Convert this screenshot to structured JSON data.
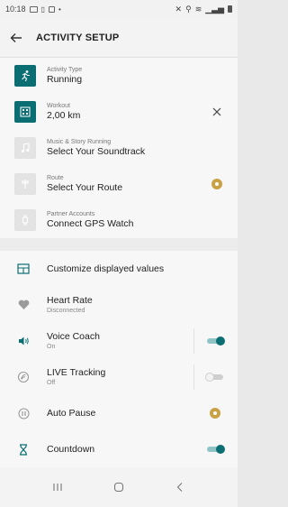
{
  "status_bar": {
    "time": "10:18",
    "icons": [
      "image-icon",
      "screen-icon",
      "notification-dot-icon"
    ],
    "right_icons": [
      "mute-icon",
      "location-icon",
      "wifi-icon",
      "signal-icon",
      "battery-icon"
    ]
  },
  "header": {
    "back_icon": "arrow-left-icon",
    "title": "ACTIVITY SETUP"
  },
  "setup": {
    "items": [
      {
        "label": "Activity Type",
        "value": "Running",
        "icon": "runner-icon",
        "tile": "teal",
        "action": ""
      },
      {
        "label": "Workout",
        "value": "2,00 km",
        "icon": "workout-grid-icon",
        "tile": "teal",
        "action": "close-icon"
      },
      {
        "label": "Music & Story Running",
        "value": "Select Your Soundtrack",
        "icon": "music-note-icon",
        "tile": "grey",
        "action": ""
      },
      {
        "label": "Route",
        "value": "Select Your Route",
        "icon": "route-sign-icon",
        "tile": "grey",
        "action": "premium-badge-icon"
      },
      {
        "label": "Partner Accounts",
        "value": "Connect GPS Watch",
        "icon": "watch-icon",
        "tile": "grey",
        "action": ""
      }
    ]
  },
  "settings": {
    "items": [
      {
        "label": "Customize displayed values",
        "sub": "",
        "icon": "display-values-icon"
      },
      {
        "label": "Heart Rate",
        "sub": "Disconnected",
        "icon": "heart-icon"
      },
      {
        "label": "Voice Coach",
        "sub": "On",
        "icon": "voice-coach-icon",
        "toggle": true
      },
      {
        "label": "LIVE Tracking",
        "sub": "Off",
        "icon": "live-tracking-icon",
        "toggle": false
      },
      {
        "label": "Auto Pause",
        "sub": "",
        "icon": "pause-icon",
        "premium": true
      },
      {
        "label": "Countdown",
        "sub": "",
        "icon": "hourglass-icon",
        "toggle": true
      }
    ]
  },
  "nav_bar": {
    "buttons": [
      "recents-icon",
      "home-icon",
      "back-icon"
    ]
  },
  "colors": {
    "accent": "#0b6e73",
    "premium": "#c9a246"
  }
}
